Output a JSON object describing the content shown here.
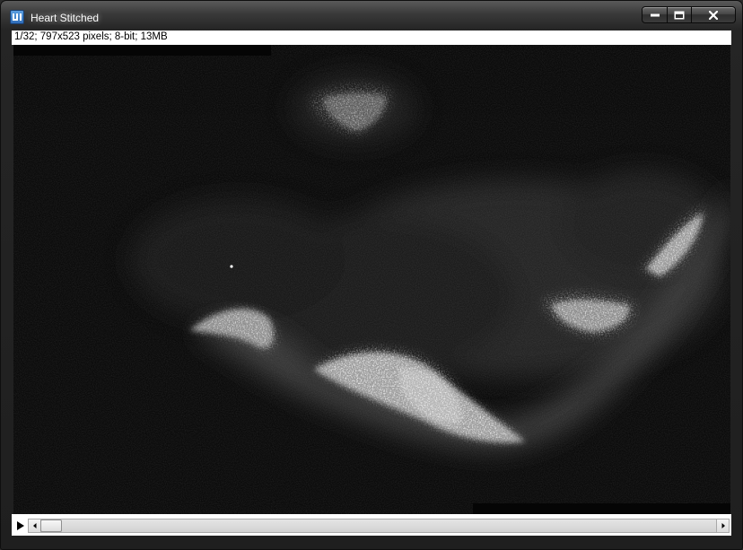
{
  "window": {
    "title": "Heart Stitched",
    "icon": "imagej-icon",
    "controls": [
      "minimize-icon",
      "maximize-icon",
      "close-icon"
    ]
  },
  "image_info": {
    "text": "1/32; 797x523 pixels; 8-bit; 13MB"
  },
  "slice_scrollbar": {
    "current_slice": 1,
    "total_slices": 32
  },
  "colors": {
    "frame": "#1f1f1f",
    "image_background": "#0b0b0b",
    "signal": "#ffffff"
  }
}
